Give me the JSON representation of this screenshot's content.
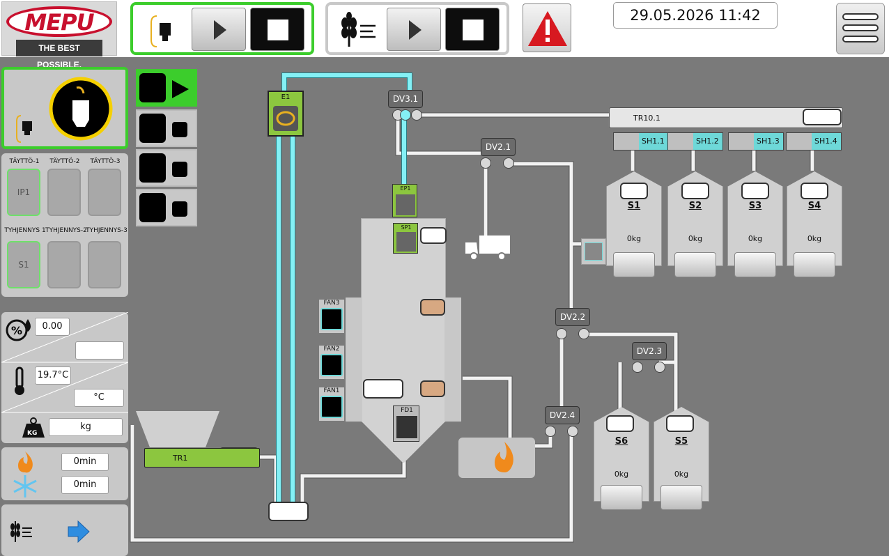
{
  "logo": {
    "brand": "MEPU",
    "tagline": "THE BEST POSSIBLE."
  },
  "header": {
    "datetime": "29.05.2026 11:42",
    "group1_icon": "elevator-icon",
    "group2_icon": "grain-dryer-icon",
    "alarm_icon": "warning-icon",
    "menu_icon": "hamburger-menu-icon"
  },
  "left_panel": {
    "fill_labels": [
      "TÄYTTÖ-1",
      "TÄYTTÖ-2",
      "TÄYTTÖ-3"
    ],
    "fill_values": [
      "IP1",
      "",
      ""
    ],
    "empty_labels": [
      "TYHJENNYS 1",
      "TYHJENNYS-2",
      "TYHJENNYS-3"
    ],
    "empty_values": [
      "S1",
      "",
      ""
    ],
    "moisture_value": "0.00",
    "moisture_target": "",
    "temperature_value": "19.7°C",
    "temperature_unit": "°C",
    "weight_unit": "kg",
    "burn_time": "0min",
    "cool_time": "0min"
  },
  "diagram": {
    "elevator": "E1",
    "ep": "EP1",
    "sp": "SP1",
    "fd": "FD1",
    "tr1": "TR1",
    "tr10": "TR10.1",
    "fans": [
      "FAN3",
      "FAN2",
      "FAN1"
    ],
    "valves": [
      "DV3.1",
      "DV2.1",
      "DV2.2",
      "DV2.3",
      "DV2.4"
    ],
    "shutters": [
      "SH1.1",
      "SH1.2",
      "SH1.3",
      "SH1.4"
    ],
    "silos_top": [
      {
        "name": "S1",
        "weight": "0kg"
      },
      {
        "name": "S2",
        "weight": "0kg"
      },
      {
        "name": "S3",
        "weight": "0kg"
      },
      {
        "name": "S4",
        "weight": "0kg"
      }
    ],
    "silos_bottom": [
      {
        "name": "S6",
        "weight": "0kg"
      },
      {
        "name": "S5",
        "weight": "0kg"
      }
    ]
  },
  "colors": {
    "active_green": "#3ccd2c",
    "pipe_cyan": "#84f0f5",
    "conveyor_green": "#8cc63f",
    "alarm_red": "#d71920"
  }
}
